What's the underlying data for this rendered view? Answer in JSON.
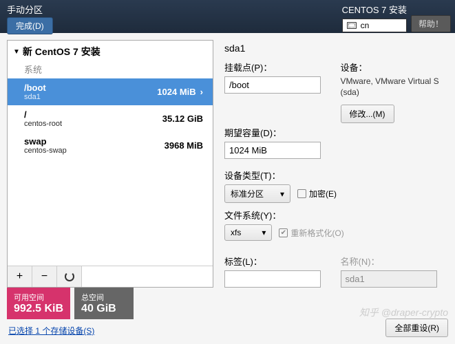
{
  "topbar": {
    "title": "手动分区",
    "done": "完成(D)",
    "install_title": "CENTOS 7 安装",
    "lang": "cn",
    "help": "帮助！"
  },
  "left": {
    "header": "新 CentOS 7 安装",
    "system_label": "系统",
    "partitions": [
      {
        "name": "/boot",
        "sub": "sda1",
        "size": "1024 MiB",
        "selected": true
      },
      {
        "name": "/",
        "sub": "centos-root",
        "size": "35.12 GiB",
        "selected": false
      },
      {
        "name": "swap",
        "sub": "centos-swap",
        "size": "3968 MiB",
        "selected": false
      }
    ],
    "add": "+",
    "remove": "−"
  },
  "right": {
    "title": "sda1",
    "mount_label": "挂载点(P)：",
    "mount_value": "/boot",
    "device_label": "设备：",
    "device_text": "VMware, VMware Virtual S (sda)",
    "modify": "修改...(M)",
    "capacity_label": "期望容量(D)：",
    "capacity_value": "1024 MiB",
    "devtype_label": "设备类型(T)：",
    "devtype_value": "标准分区",
    "encrypt": "加密(E)",
    "fs_label": "文件系统(Y)：",
    "fs_value": "xfs",
    "reformat": "重新格式化(O)",
    "tag_label": "标签(L)：",
    "tag_value": "",
    "name_label": "名称(N)：",
    "name_value": "sda1"
  },
  "footer": {
    "avail_label": "可用空间",
    "avail_value": "992.5 KiB",
    "total_label": "总空间",
    "total_value": "40 GiB",
    "storage_link": "已选择 1 个存储设备(S)",
    "reset": "全部重设(R)"
  },
  "watermark": "知乎 @draper-crypto"
}
